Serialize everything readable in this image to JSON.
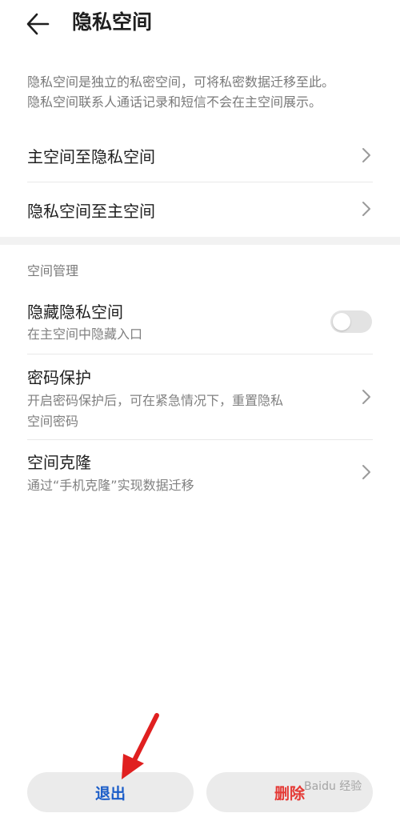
{
  "header": {
    "title": "隐私空间",
    "back_icon": "arrow-left-icon"
  },
  "description": {
    "line1": "隐私空间是独立的私密空间，可将私密数据迁移至此。",
    "line2": "隐私空间联系人通话记录和短信不会在主空间展示。"
  },
  "transfer": {
    "main_to_private": "主空间至隐私空间",
    "private_to_main": "隐私空间至主空间"
  },
  "management": {
    "section_title": "空间管理",
    "hide": {
      "title": "隐藏隐私空间",
      "subtitle": "在主空间中隐藏入口",
      "enabled": false
    },
    "password": {
      "title": "密码保护",
      "subtitle_line1": "开启密码保护后，可在紧急情况下，重置隐私",
      "subtitle_line2": "空间密码"
    },
    "clone": {
      "title": "空间克隆",
      "subtitle": "通过“手机克隆”实现数据迁移"
    }
  },
  "buttons": {
    "exit_label": "退出",
    "delete_label": "删除"
  },
  "colors": {
    "exit": "#1a5cc8",
    "delete": "#e53935",
    "annotation_arrow": "#e02020"
  },
  "watermark": {
    "text": "Baidu 经验"
  }
}
